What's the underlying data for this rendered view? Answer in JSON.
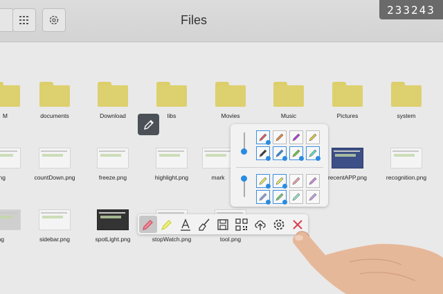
{
  "header": {
    "title": "Files",
    "counter": "233243",
    "buttons": [
      "back",
      "grid-view",
      "settings"
    ]
  },
  "folders": [
    {
      "label": "M"
    },
    {
      "label": "documents"
    },
    {
      "label": "Download"
    },
    {
      "label": "libs"
    },
    {
      "label": "Movies"
    },
    {
      "label": "Music"
    },
    {
      "label": "Pictures"
    },
    {
      "label": "system"
    }
  ],
  "row2": [
    {
      "label": ".png"
    },
    {
      "label": "countDown.png"
    },
    {
      "label": "freeze.png"
    },
    {
      "label": "highlight.png"
    },
    {
      "label": "mark"
    },
    {
      "label": "recentAPP.png"
    },
    {
      "label": "recognition.png"
    }
  ],
  "row3": [
    {
      "label": "p.png"
    },
    {
      "label": "sidebar.png"
    },
    {
      "label": "spotLight.png"
    },
    {
      "label": "stopWatch.png"
    },
    {
      "label": "tool.png"
    }
  ],
  "palette": {
    "pens_top": [
      "#e0566f",
      "#e8893a",
      "#b03ad9",
      "#e3c83a",
      "#3a3a3a",
      "#2b8be0",
      "#6cc93a",
      "#5fe0b8"
    ],
    "pens_bottom": [
      "#e3e85a",
      "#e3e85a",
      "#f0a0a8",
      "#d08ae0",
      "#8aa0e8",
      "#6fd06f",
      "#90e8c8",
      "#c8a0e8"
    ]
  },
  "pen_toolbar": {
    "tools": [
      "pen-icon",
      "highlighter-icon",
      "text-icon",
      "eraser-icon",
      "save-icon",
      "qr-code-icon",
      "cloud-upload-icon",
      "gear-icon",
      "close-icon"
    ]
  }
}
